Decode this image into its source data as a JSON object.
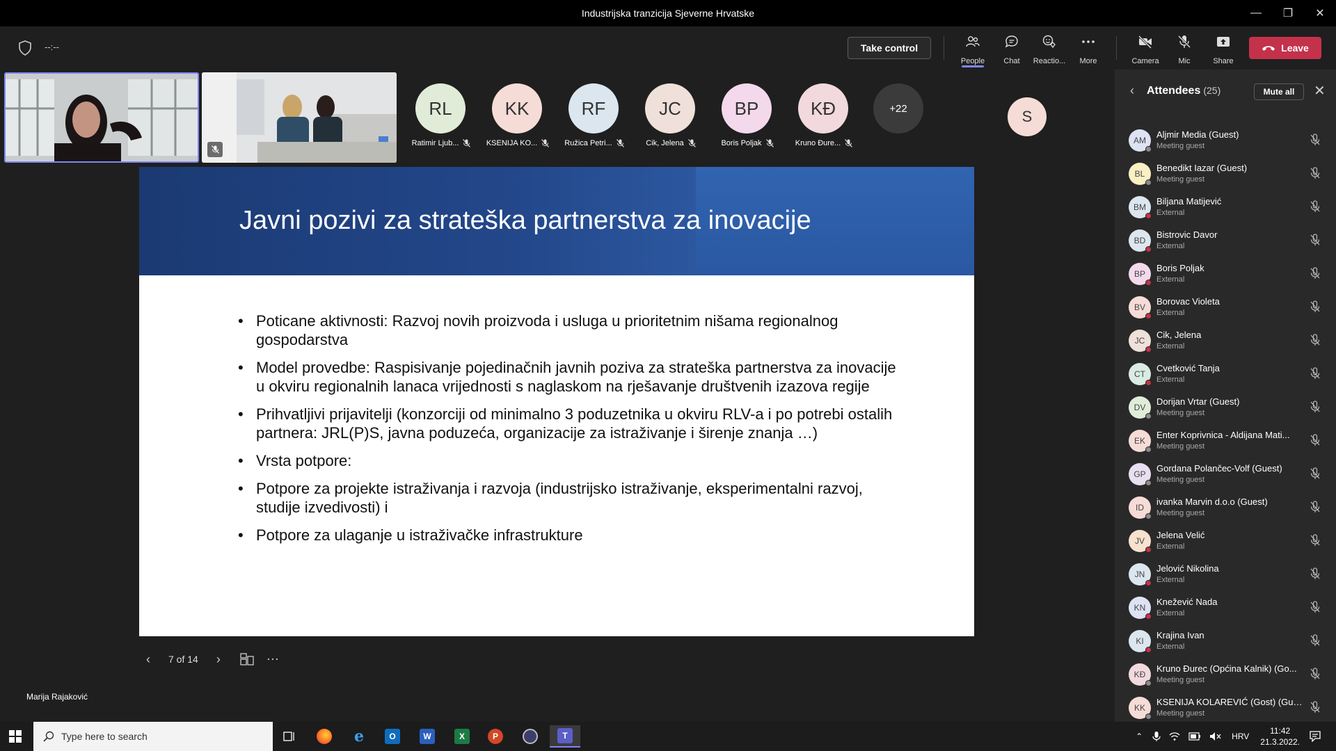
{
  "window": {
    "title": "Industrijska tranzicija Sjeverne Hrvatske"
  },
  "toolbar": {
    "timer": "--:--",
    "take_control": "Take control",
    "people": "People",
    "chat": "Chat",
    "reactions": "Reactio...",
    "more": "More",
    "camera": "Camera",
    "mic": "Mic",
    "share": "Share",
    "leave": "Leave"
  },
  "strip": [
    {
      "initials": "RL",
      "name": "Ratimir Ljub...",
      "color": "#e1ecd8"
    },
    {
      "initials": "KK",
      "name": "KSENIJA KO...",
      "color": "#f6dcd6"
    },
    {
      "initials": "RF",
      "name": "Ružica Petri...",
      "color": "#dbe6ee"
    },
    {
      "initials": "JC",
      "name": "Cik, Jelena",
      "color": "#efe0da"
    },
    {
      "initials": "BP",
      "name": "Boris Poljak",
      "color": "#f4d9ec"
    },
    {
      "initials": "KĐ",
      "name": "Kruno Đure...",
      "color": "#f2d9de"
    }
  ],
  "overflow": "+22",
  "spotlight_initial": "S",
  "slide": {
    "title": "Javni pozivi za strateška partnerstva za inovacije",
    "bullets": [
      "Poticane aktivnosti: Razvoj novih proizvoda i usluga u prioritetnim nišama regionalnog gospodarstva",
      "Model provedbe: Raspisivanje pojedinačnih javnih poziva za strateška partnerstva za inovacije u okviru regionalnih lanaca vrijednosti s naglaskom na rješavanje društvenih izazova regije",
      "Prihvatljivi prijavitelji (konzorciji od minimalno 3 poduzetnika u okviru RLV-a i po potrebi ostalih partnera: JRL(P)S, javna poduzeća, organizacije za istraživanje i širenje znanja …)",
      "Vrsta potpore:",
      "Potpore za projekte istraživanja i razvoja (industrijsko istraživanje, eksperimentalni razvoj, studije izvedivosti) i",
      "Potpore za ulaganje u istraživačke infrastrukture"
    ],
    "page": "7 of 14"
  },
  "presenter": "Marija Rajaković",
  "panel": {
    "title": "Attendees",
    "count": "(25)",
    "mute_all": "Mute all",
    "attendees": [
      {
        "initials": "AM",
        "name": "Aljmir Media (Guest)",
        "role": "Meeting guest",
        "color": "#dde3f3",
        "status": "#8a8a8a"
      },
      {
        "initials": "BL",
        "name": "Benedikt Iazar (Guest)",
        "role": "Meeting guest",
        "color": "#fbf0c4",
        "status": "#8a8a8a"
      },
      {
        "initials": "BM",
        "name": "Biljana Matijević",
        "role": "External",
        "color": "#dbe6ee",
        "status": "#c4314b"
      },
      {
        "initials": "BD",
        "name": "Bistrovic Davor",
        "role": "External",
        "color": "#dbe6ee",
        "status": "#c4314b"
      },
      {
        "initials": "BP",
        "name": "Boris Poljak",
        "role": "External",
        "color": "#f4d9ec",
        "status": "#c4314b"
      },
      {
        "initials": "BV",
        "name": "Borovac Violeta",
        "role": "External",
        "color": "#f6dcd6",
        "status": "#c4314b"
      },
      {
        "initials": "JC",
        "name": "Cik, Jelena",
        "role": "External",
        "color": "#efe0da",
        "status": "#c4314b"
      },
      {
        "initials": "CT",
        "name": "Cvetković Tanja",
        "role": "External",
        "color": "#d9ebe3",
        "status": "#c4314b"
      },
      {
        "initials": "DV",
        "name": "Dorijan Vrtar (Guest)",
        "role": "Meeting guest",
        "color": "#e1ecd8",
        "status": "#8a8a8a"
      },
      {
        "initials": "EK",
        "name": "Enter Koprivnica - Aldijana Mati...",
        "role": "Meeting guest",
        "color": "#f6dcd6",
        "status": "#8a8a8a"
      },
      {
        "initials": "GP",
        "name": "Gordana Polančec-Volf (Guest)",
        "role": "Meeting guest",
        "color": "#e8e0f0",
        "status": "#8a8a8a"
      },
      {
        "initials": "ID",
        "name": "ivanka Marvin d.o.o (Guest)",
        "role": "Meeting guest",
        "color": "#f6dcd6",
        "status": "#8a8a8a"
      },
      {
        "initials": "JV",
        "name": "Jelena Velić",
        "role": "External",
        "color": "#f6e2cf",
        "status": "#c4314b"
      },
      {
        "initials": "JN",
        "name": "Jelović Nikolina",
        "role": "External",
        "color": "#dbe6ee",
        "status": "#c4314b"
      },
      {
        "initials": "KN",
        "name": "Knežević Nada",
        "role": "External",
        "color": "#dde3f3",
        "status": "#c4314b"
      },
      {
        "initials": "KI",
        "name": "Krajina Ivan",
        "role": "External",
        "color": "#dbe6ee",
        "status": "#c4314b"
      },
      {
        "initials": "KĐ",
        "name": "Kruno Đurec (Općina Kalnik) (Go...",
        "role": "Meeting guest",
        "color": "#f2d9de",
        "status": "#8a8a8a"
      },
      {
        "initials": "KK",
        "name": "KSENIJA KOLAREVIĆ (Gost) (Gue...",
        "role": "Meeting guest",
        "color": "#f6dcd6",
        "status": "#8a8a8a"
      }
    ]
  },
  "taskbar": {
    "search_placeholder": "Type here to search",
    "lang": "HRV",
    "time": "11:42",
    "date": "21.3.2022."
  }
}
